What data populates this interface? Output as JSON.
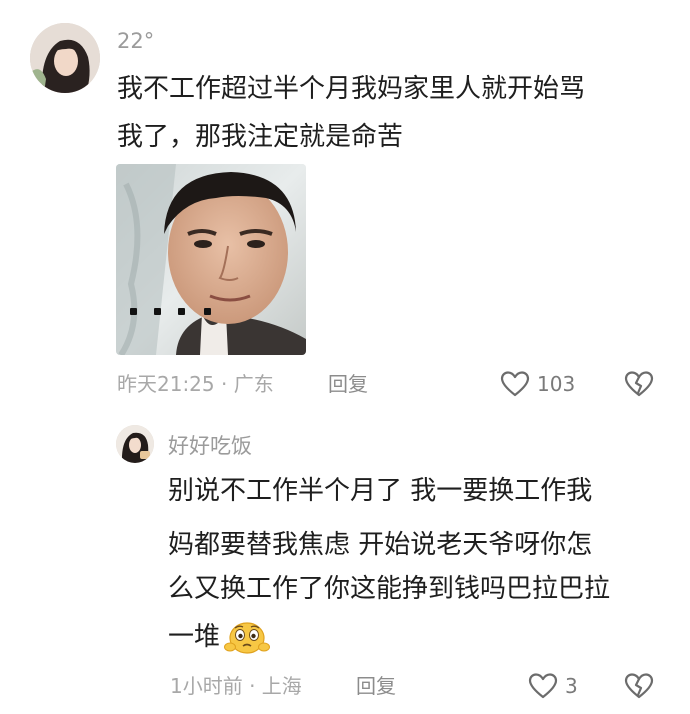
{
  "comment": {
    "username": "22°",
    "text_lines": [
      "我不工作超过半个月我妈家里人就开始骂",
      "我了，那我注定就是命苦"
    ],
    "image_icon": "meme-photo-man-face-icon",
    "time_location": "昨天21:25 · 广东",
    "reply_label": "回复",
    "like_count": "103",
    "like_icon": "heart-outline-icon",
    "dislike_icon": "broken-heart-icon"
  },
  "reply": {
    "username": "好好吃饭",
    "text_lines": [
      "别说不工作半个月了  我一要换工作我",
      "妈都要替我焦虑  开始说老天爷呀你怎",
      "么又换工作了你这能挣到钱吗巴拉巴拉",
      "一堆"
    ],
    "emoji_icon": "worried-face-emoji-icon",
    "time_location": "1小时前 · 上海",
    "reply_label": "回复",
    "like_count": "3",
    "like_icon": "heart-outline-icon",
    "dislike_icon": "broken-heart-icon"
  }
}
